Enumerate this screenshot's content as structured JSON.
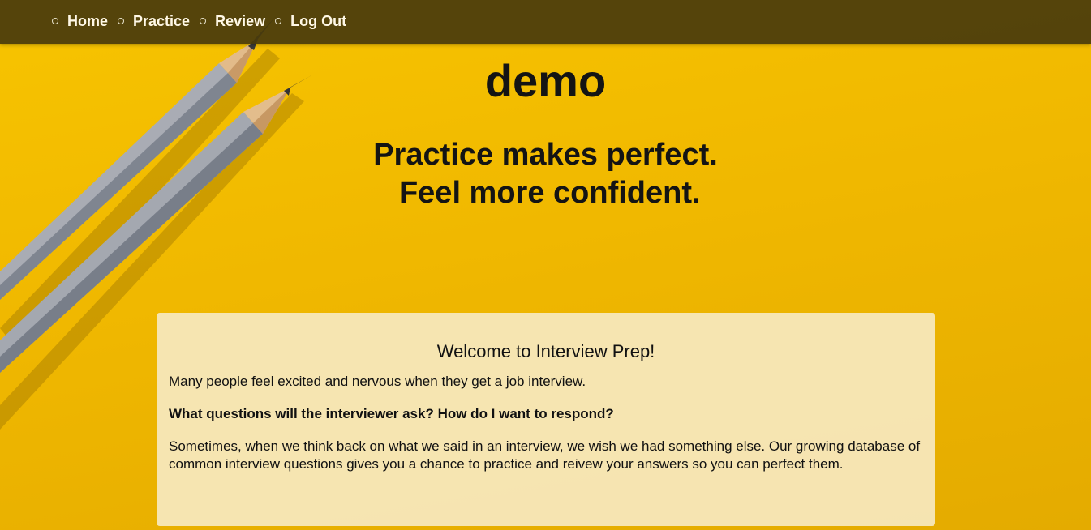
{
  "nav": {
    "items": [
      {
        "label": "Home"
      },
      {
        "label": "Practice"
      },
      {
        "label": "Review"
      },
      {
        "label": "Log Out"
      }
    ]
  },
  "hero": {
    "title": "demo",
    "tagline_line1": "Practice makes perfect.",
    "tagline_line2": " Feel more confident."
  },
  "welcome": {
    "heading": "Welcome to Interview Prep!",
    "intro": "Many people feel excited and nervous when they get a job interview.",
    "question": "What questions will the interviewer ask? How do I want to respond?",
    "body": "Sometimes, when we think back on what we said in an interview, we wish we had something else. Our growing database of common interview questions gives you a chance to practice and reivew your answers so you can perfect them."
  },
  "colors": {
    "background": "#f2bc00",
    "navbar": "#483a0c",
    "card": "#f6e8be",
    "text": "#141414"
  },
  "background_image": "two-pencils-on-yellow"
}
